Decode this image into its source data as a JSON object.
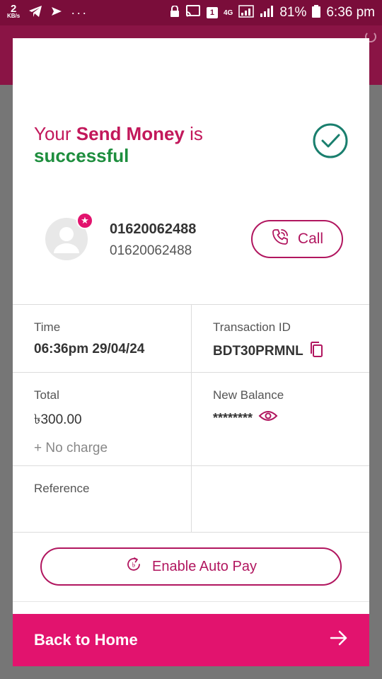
{
  "status_bar": {
    "speed_value": "2",
    "speed_unit": "KB/s",
    "dots": "···",
    "sim_slot": "1",
    "network": "4G",
    "battery_percent": "81%",
    "time": "6:36 pm"
  },
  "headline": {
    "prefix": "Your ",
    "action": "Send Money",
    "suffix": " is",
    "status": "successful"
  },
  "recipient": {
    "name": "01620062488",
    "number": "01620062488",
    "call_label": "Call"
  },
  "details": {
    "time_label": "Time",
    "time_value": "06:36pm 29/04/24",
    "txid_label": "Transaction ID",
    "txid_value": "BDT30PRMNL",
    "total_label": "Total",
    "total_value": "৳300.00",
    "charge_note": "+ No charge",
    "balance_label": "New Balance",
    "balance_value": "********",
    "reference_label": "Reference",
    "reference_value": ""
  },
  "autopay_label": "Enable Auto Pay",
  "back_home_label": "Back to Home",
  "colors": {
    "brand": "#e2136e",
    "brand_dark": "#b1165f",
    "success": "#1e8e3e",
    "check_circle": "#1a7f6e"
  }
}
